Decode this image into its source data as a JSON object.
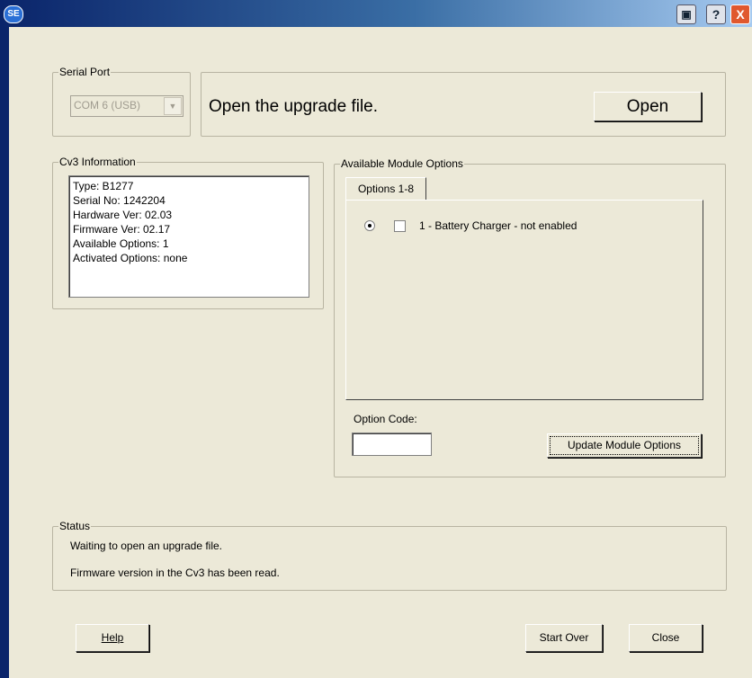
{
  "titlebar": {
    "app_icon_text": "SE",
    "restore_icon": "restore-icon",
    "help_label": "?",
    "close_label": "X"
  },
  "serial_port": {
    "legend": "Serial Port",
    "selected": "COM 6 (USB)"
  },
  "open_section": {
    "instruction": "Open the upgrade file.",
    "open_button": "Open"
  },
  "cv3_info": {
    "legend": "Cv3 Information",
    "lines": [
      "Type: B1277",
      "Serial No: 1242204",
      "Hardware Ver: 02.03",
      "Firmware Ver: 02.17",
      "Available Options: 1",
      "Activated Options: none"
    ]
  },
  "module_options": {
    "legend": "Available Module Options",
    "tab_label": "Options 1-8",
    "option_1_label": "1 - Battery Charger - not enabled",
    "option_1_radio_selected": true,
    "option_1_checked": false,
    "option_code_label": "Option Code:",
    "option_code_value": "",
    "update_button": "Update Module Options"
  },
  "status": {
    "legend": "Status",
    "messages": [
      "Waiting to open an upgrade file.",
      "Firmware version in the Cv3 has been read."
    ]
  },
  "footer": {
    "help_button": "Help",
    "start_over_button": "Start Over",
    "close_button": "Close"
  }
}
